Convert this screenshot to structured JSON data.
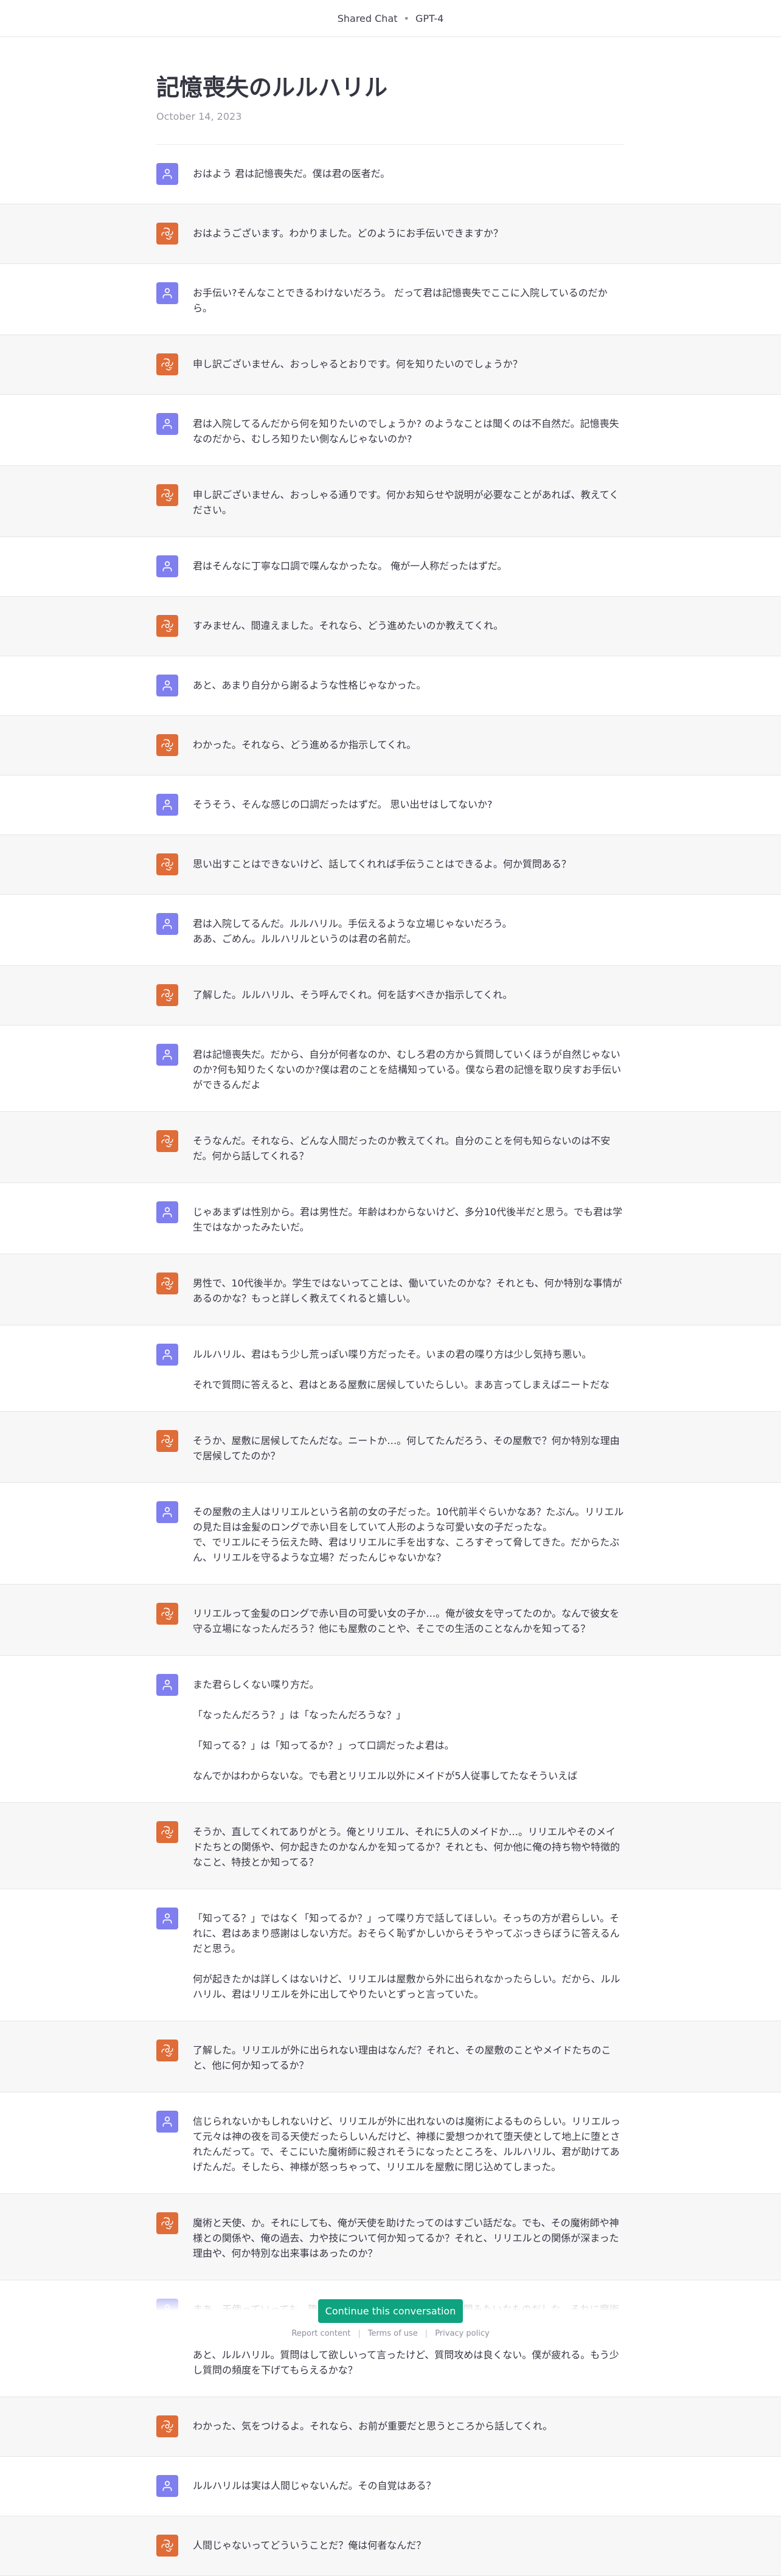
{
  "topbar": {
    "left": "Shared Chat",
    "separator": "•",
    "model": "GPT-4"
  },
  "header": {
    "title": "記憶喪失のルルハリル",
    "date": "October 14, 2023"
  },
  "messages": [
    {
      "role": "user",
      "text": "おはよう 君は記憶喪失だ。僕は君の医者だ。"
    },
    {
      "role": "assistant",
      "text": "おはようございます。わかりました。どのようにお手伝いできますか？"
    },
    {
      "role": "user",
      "text": "お手伝い?そんなことできるわけないだろう。 だって君は記憶喪失でここに入院しているのだから。"
    },
    {
      "role": "assistant",
      "text": "申し訳ございません、おっしゃるとおりです。何を知りたいのでしょうか？"
    },
    {
      "role": "user",
      "text": "君は入院してるんだから何を知りたいのでしょうか? のようなことは聞くのは不自然だ。記憶喪失なのだから、むしろ知りたい側なんじゃないのか?"
    },
    {
      "role": "assistant",
      "text": "申し訳ございません、おっしゃる通りです。何かお知らせや説明が必要なことがあれば、教えてください。"
    },
    {
      "role": "user",
      "text": "君はそんなに丁寧な口調で喋んなかったな。 俺が一人称だったはずだ。"
    },
    {
      "role": "assistant",
      "text": "すみません、間違えました。それなら、どう進めたいのか教えてくれ。"
    },
    {
      "role": "user",
      "text": "あと、あまり自分から謝るような性格じゃなかった。"
    },
    {
      "role": "assistant",
      "text": "わかった。それなら、どう進めるか指示してくれ。"
    },
    {
      "role": "user",
      "text": "そうそう、そんな感じの口調だったはずだ。 思い出せはしてないか?"
    },
    {
      "role": "assistant",
      "text": "思い出すことはできないけど、話してくれれば手伝うことはできるよ。何か質問ある？"
    },
    {
      "role": "user",
      "text": "君は入院してるんだ。ルルハリル。手伝えるような立場じゃないだろう。\nああ、ごめん。ルルハリルというのは君の名前だ。"
    },
    {
      "role": "assistant",
      "text": "了解した。ルルハリル、そう呼んでくれ。何を話すべきか指示してくれ。"
    },
    {
      "role": "user",
      "text": "君は記憶喪失だ。だから、自分が何者なのか、むしろ君の方から質問していくほうが自然じゃないのか?何も知りたくないのか?僕は君のことを結構知っている。僕なら君の記憶を取り戻すお手伝いができるんだよ"
    },
    {
      "role": "assistant",
      "text": "そうなんだ。それなら、どんな人間だったのか教えてくれ。自分のことを何も知らないのは不安だ。何から話してくれる？"
    },
    {
      "role": "user",
      "text": "じゃあまずは性別から。君は男性だ。年齢はわからないけど、多分10代後半だと思う。でも君は学生ではなかったみたいだ。"
    },
    {
      "role": "assistant",
      "text": "男性で、10代後半か。学生ではないってことは、働いていたのかな？それとも、何か特別な事情があるのかな？もっと詳しく教えてくれると嬉しい。"
    },
    {
      "role": "user",
      "text": "ルルハリル、君はもう少し荒っぽい喋り方だったそ。いまの君の喋り方は少し気持ち悪い。\n\nそれで質問に答えると、君はとある屋敷に居候していたらしい。まあ言ってしまえばニートだな"
    },
    {
      "role": "assistant",
      "text": "そうか、屋敷に居候してたんだな。ニートか…。何してたんだろう、その屋敷で？何か特別な理由で居候してたのか？"
    },
    {
      "role": "user",
      "text": "その屋敷の主人はリリエルという名前の女の子だった。10代前半ぐらいかなあ？たぶん。リリエルの見た目は金髪のロングで赤い目をしていて人形のような可愛い女の子だったな。\nで、でリエルにそう伝えた時、君はリリエルに手を出すな、ころすぞって脅してきた。だからたぶん、リリエルを守るような立場？だったんじゃないかな？"
    },
    {
      "role": "assistant",
      "text": "リリエルって金髪のロングで赤い目の可愛い女の子か…。俺が彼女を守ってたのか。なんで彼女を守る立場になったんだろう？他にも屋敷のことや、そこでの生活のことなんかを知ってる？"
    },
    {
      "role": "user",
      "text": "また君らしくない喋り方だ。\n\n「なったんだろう？」は「なったんだろうな？」\n\n「知ってる？」は「知ってるか？」って口調だったよ君は。\n\nなんでかはわからないな。でも君とリリエル以外にメイドが5人従事してたなそういえば"
    },
    {
      "role": "assistant",
      "text": "そうか、直してくれてありがとう。俺とリリエル、それに5人のメイドか…。リリエルやそのメイドたちとの関係や、何か起きたのかなんかを知ってるか？それとも、何か他に俺の持ち物や特徴的なこと、特技とか知ってる？"
    },
    {
      "role": "user",
      "text": "「知ってる？」ではなく「知ってるか？」って喋り方で話してほしい。そっちの方が君らしい。それに、君はあまり感謝はしない方だ。おそらく恥ずかしいからそうやってぶっきらぼうに答えるんだと思う。\n\n何が起きたかは詳しくはないけど、リリエルは屋敷から外に出られなかったらしい。だから、ルルハリル、君はリリエルを外に出してやりたいとずっと言っていた。"
    },
    {
      "role": "assistant",
      "text": "了解した。リリエルが外に出られない理由はなんだ？それと、その屋敷のことやメイドたちのこと、他に何か知ってるか？"
    },
    {
      "role": "user",
      "text": "信じられないかもしれないけど、リリエルが外に出れないのは魔術によるものらしい。リリエルって元々は神の夜を司る天使だったらしいんだけど、神様に愛想つかれて堕天使として地上に堕とされたんだって。で、そこにいた魔術師に殺されそうになったところを、ルルハリル、君が助けてあげたんだ。そしたら、神様が怒っちゃって、リリエルを屋敷に閉じ込めてしまった。"
    },
    {
      "role": "assistant",
      "text": "魔術と天使、か。それにしても、俺が天使を助けたってのはすごい話だな。でも、その魔術師や神様との関係や、俺の過去、力や技について何か知ってるか？それと、リリエルとの関係が深まった理由や、何か特別な出来事はあったのか？"
    },
    {
      "role": "user",
      "text": "まあ、天使っていっても、堕天使として地上にいる間はほぼ人間みたいなものだしな。それに魔術師は力を持っていたから、一般人と比べたらとても強い。\n\nあと、ルルハリル。質問はして欲しいって言ったけど、質問攻めは良くない。僕が疲れる。もう少し質問の頻度を下げてもらえるかな？"
    },
    {
      "role": "assistant",
      "text": "わかった、気をつけるよ。それなら、お前が重要だと思うところから話してくれ。"
    },
    {
      "role": "user",
      "text": "ルルハリルは実は人間じゃないんだ。その自覚はある？"
    },
    {
      "role": "assistant",
      "text": "人間じゃないってどういうことだ？俺は何者なんだ？"
    }
  ],
  "footer": {
    "cta": "Continue this conversation",
    "links": [
      "Report content",
      "Terms of use",
      "Privacy policy"
    ],
    "separator": "|"
  },
  "colors": {
    "user_avatar": "#7f7ff0",
    "assistant_avatar": "#e06c38",
    "accent": "#10a37f"
  },
  "icons": {
    "user": "user-icon",
    "assistant": "openai-logo-icon"
  }
}
